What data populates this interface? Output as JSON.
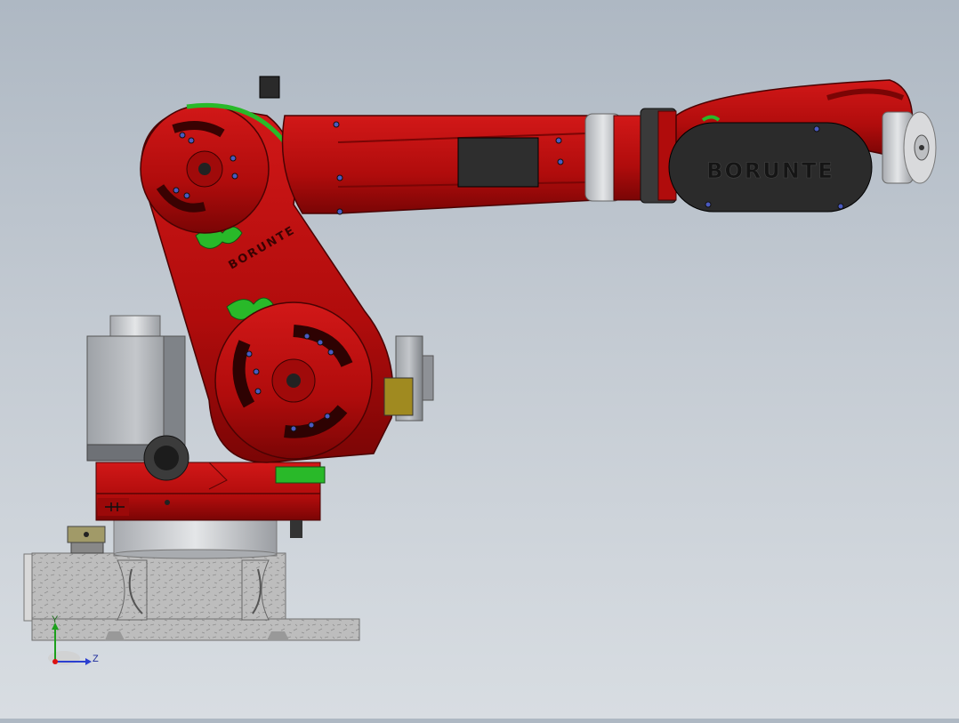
{
  "model": {
    "brand_logo_text": "BORUNTE",
    "arm_logo_text": "BORUNTE"
  },
  "triad": {
    "y_label": "Y",
    "z_label": "Z"
  },
  "colors": {
    "robot_red": "#b50d0d",
    "robot_red_dark": "#7e0606",
    "accent_green": "#29b929",
    "motor_gray": "#8d9196",
    "base_stone": "#b8b8b8",
    "cover_black": "#2b2b2b"
  }
}
